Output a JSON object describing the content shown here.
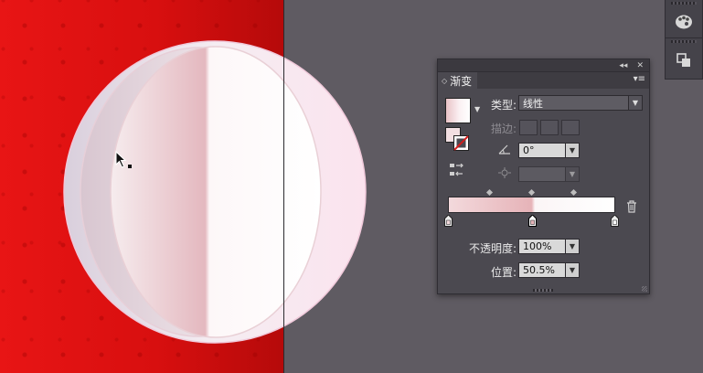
{
  "colors": {
    "canvas_bg": "#5f5b62",
    "document_fill": "#e01414",
    "panel_bg": "#4b4950",
    "gradient_start": "#f3d9dc",
    "gradient_mid": "#e6b3b8",
    "gradient_end": "#ffffff"
  },
  "dock": {
    "icons": [
      "palette-icon",
      "layers-icon"
    ]
  },
  "panel": {
    "title_controls": {
      "collapse": "◂◂",
      "close": "✕"
    },
    "tab_label": "渐变",
    "tab_arrows": "◇",
    "menu": "▾≡",
    "type_label": "类型:",
    "type_value": "线性",
    "stroke_label": "描边:",
    "angle_value": "0°",
    "aspect_value": "",
    "opacity_label": "不透明度:",
    "opacity_value": "100%",
    "location_label": "位置:",
    "location_value": "50.5%"
  },
  "gradient": {
    "stops": [
      0,
      50.5,
      100
    ],
    "midpoints": [
      25,
      50.5,
      75
    ]
  }
}
